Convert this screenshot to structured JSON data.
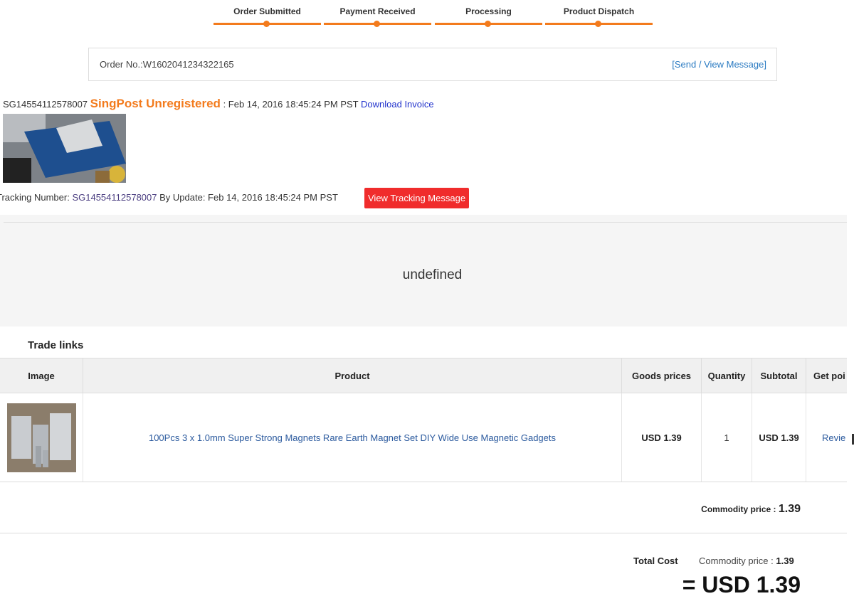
{
  "steps": [
    "Order Submitted",
    "Payment Received",
    "Processing",
    "Product Dispatch"
  ],
  "order": {
    "label": "Order No.:",
    "number": "W1602041234322165",
    "message_link": "[Send / View Message]"
  },
  "shipment": {
    "id": "SG14554112578007",
    "carrier": "SingPost Unregistered",
    "date": ": Feb 14, 2016 18:45:24 PM PST",
    "invoice_link": "Download Invoice"
  },
  "tracking": {
    "label": "Tracking Number:",
    "number": "SG14554112578007",
    "update": "By Update: Feb 14, 2016 18:45:24 PM PST",
    "button": "View Tracking Message"
  },
  "panel_text": "undefined",
  "trade": {
    "title": "Trade links",
    "headers": [
      "Image",
      "Product",
      "Goods prices",
      "Quantity",
      "Subtotal",
      "Get poi"
    ],
    "row": {
      "product": "100Pcs 3 x 1.0mm Super Strong Magnets Rare Earth Magnet Set DIY Wide Use Magnetic Gadgets",
      "price": "USD 1.39",
      "quantity": "1",
      "subtotal": "USD 1.39",
      "action": "Revie"
    }
  },
  "summary": {
    "commodity_label": "Commodity price :",
    "commodity_value": "1.39",
    "total_label": "Total Cost",
    "total_cp_label": "Commodity price :",
    "total_cp_value": "1.39",
    "grand_total": "= USD 1.39"
  },
  "colors": {
    "accent": "#f37b1d",
    "link": "#2b7bc2",
    "button": "#f02c2c"
  }
}
